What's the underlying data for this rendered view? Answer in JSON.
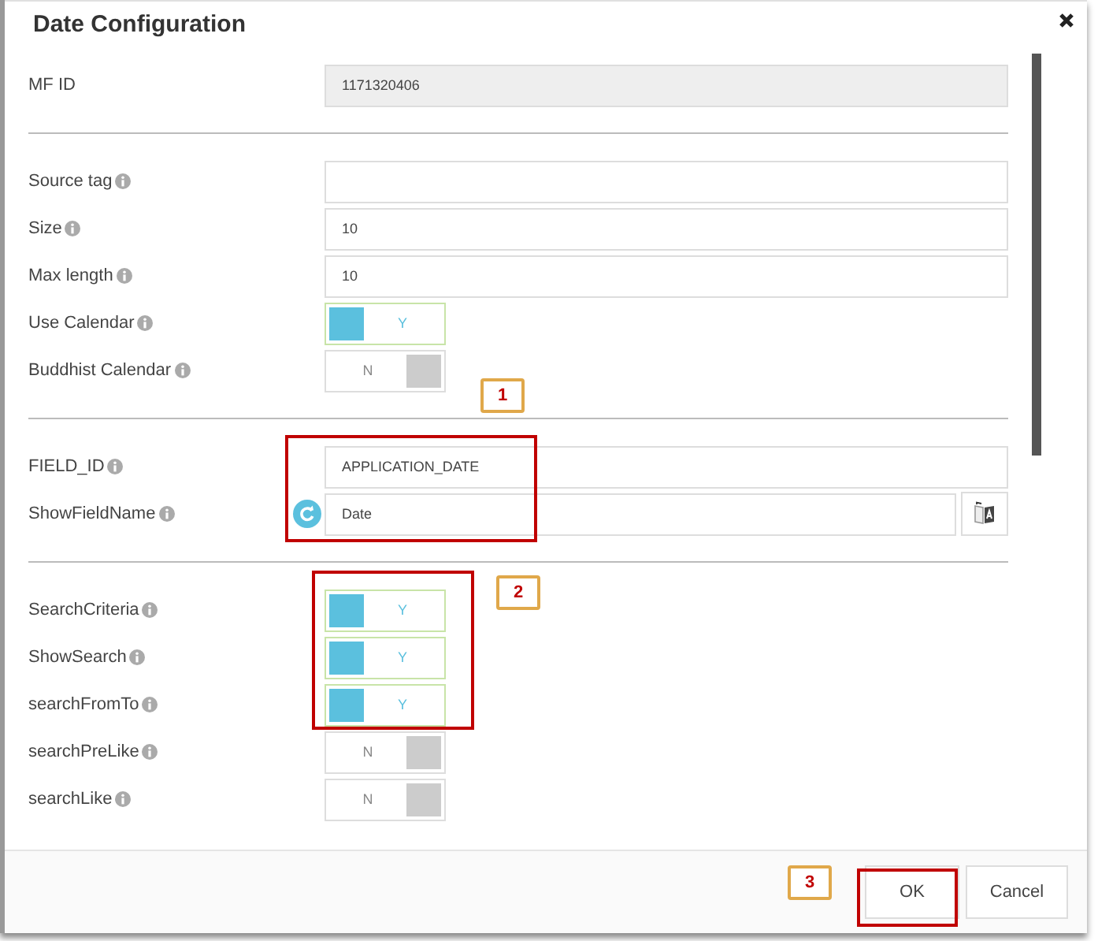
{
  "dialog": {
    "title": "Date Configuration"
  },
  "sections": [
    {
      "fields": [
        {
          "label": "MF ID",
          "info": false,
          "kind": "readonly",
          "value": "1171320406"
        }
      ]
    },
    {
      "fields": [
        {
          "label": "Source tag",
          "info": true,
          "kind": "text"
        },
        {
          "label": "Size",
          "info": true,
          "kind": "text",
          "value": "10"
        },
        {
          "label": "Max length",
          "info": true,
          "kind": "text",
          "value": "10"
        },
        {
          "label": "Use Calendar",
          "info": true,
          "kind": "toggle",
          "on": true,
          "text": "Y"
        },
        {
          "label": "Buddhist Calendar",
          "info": true,
          "kind": "toggle",
          "on": false,
          "text": "N"
        }
      ]
    },
    {
      "fields": [
        {
          "label": "FIELD_ID",
          "info": true,
          "kind": "text",
          "value": "APPLICATION_DATE"
        },
        {
          "label": "ShowFieldName",
          "info": true,
          "kind": "translatable",
          "value": "Date"
        }
      ]
    },
    {
      "fields": [
        {
          "label": "SearchCriteria",
          "info": true,
          "kind": "toggle",
          "on": true,
          "text": "Y"
        },
        {
          "label": "ShowSearch",
          "info": true,
          "kind": "toggle",
          "on": true,
          "text": "Y"
        },
        {
          "label": "searchFromTo",
          "info": true,
          "kind": "toggle",
          "on": true,
          "text": "Y"
        },
        {
          "label": "searchPreLike",
          "info": true,
          "kind": "toggle",
          "on": false,
          "text": "N"
        },
        {
          "label": "searchLike",
          "info": true,
          "kind": "toggle",
          "on": false,
          "text": "N"
        }
      ]
    }
  ],
  "buttons": [
    {
      "label": "OK"
    },
    {
      "label": "Cancel"
    }
  ],
  "annotations": [
    {
      "number": "1"
    },
    {
      "number": "2"
    },
    {
      "number": "3"
    }
  ]
}
